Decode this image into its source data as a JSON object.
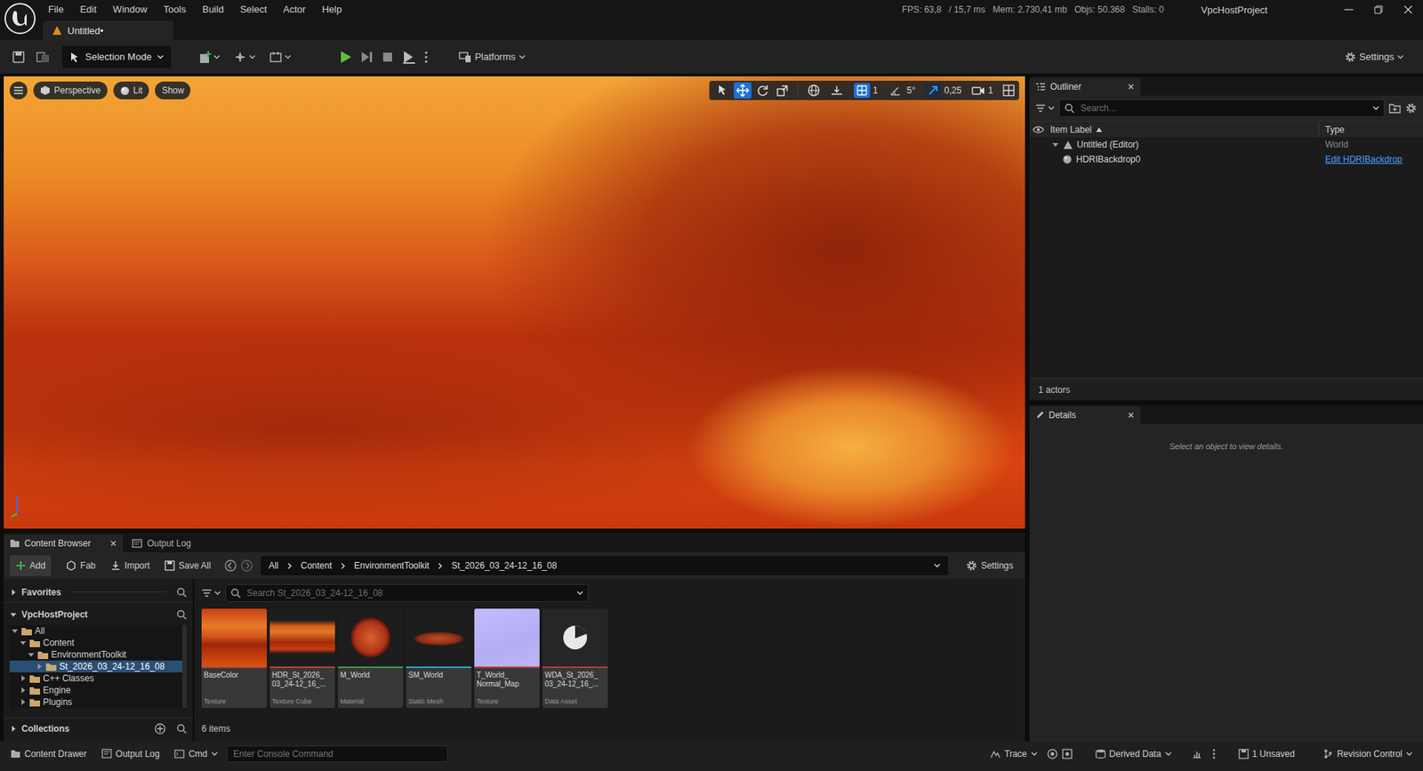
{
  "project": "VpcHostProject",
  "menu": [
    "File",
    "Edit",
    "Window",
    "Tools",
    "Build",
    "Select",
    "Actor",
    "Help"
  ],
  "stats": [
    "FPS: 63,8",
    "/ 15,7 ms",
    "Mem: 2.730,41 mb",
    "Objs: 50.368",
    "Stalls: 0"
  ],
  "level_tab": {
    "label": "Untitled•",
    "selected": true
  },
  "toolbar": {
    "mode": "Selection Mode",
    "platforms": "Platforms",
    "settings": "Settings"
  },
  "viewport": {
    "view_buttons": [
      {
        "label": "Perspective",
        "kind": "camera"
      },
      {
        "label": "Lit",
        "kind": "lighting"
      },
      {
        "label": "Show",
        "kind": "plain"
      }
    ],
    "transform_tools": [
      {
        "kind": "select",
        "selected": false
      },
      {
        "kind": "translate",
        "selected": true
      },
      {
        "kind": "rotate",
        "selected": false
      },
      {
        "kind": "scale",
        "selected": false
      }
    ],
    "snaps": [
      {
        "kind": "grid",
        "value": "1",
        "on": true
      },
      {
        "kind": "rotation",
        "value": "5°",
        "on": false
      },
      {
        "kind": "scale",
        "value": "0,25",
        "on": true
      }
    ],
    "camera_speed": "1"
  },
  "outliner": {
    "title": "Outliner",
    "search_placeholder": "Search...",
    "columns": [
      "Item Label",
      "Type"
    ],
    "sort_ascending": true,
    "rows": [
      {
        "label": "Untitled (Editor)",
        "type": "World",
        "kind": "world",
        "expanded": true,
        "link": false
      },
      {
        "label": "HDRIBackdrop0",
        "type": "Edit HDRIBackdrop",
        "kind": "actor",
        "expanded": false,
        "link": true
      }
    ],
    "footer": "1 actors"
  },
  "details": {
    "title": "Details",
    "empty_text": "Select an object to view details."
  },
  "content_browser": {
    "tabs": [
      {
        "label": "Content Browser",
        "selected": true
      },
      {
        "label": "Output Log",
        "selected": false
      }
    ],
    "actions": [
      "Add",
      "Fab",
      "Import",
      "Save All"
    ],
    "breadcrumb": [
      "All",
      "Content",
      "EnvironmentToolkit",
      "St_2026_03_24-12_16_08"
    ],
    "settings": "Settings",
    "sources": {
      "favorites": "Favorites",
      "favorites_expanded": false,
      "project": "VpcHostProject",
      "project_expanded": true,
      "tree": [
        {
          "label": "All",
          "level": 0,
          "expanded": true,
          "selected": false
        },
        {
          "label": "Content",
          "level": 1,
          "expanded": true,
          "selected": false
        },
        {
          "label": "EnvironmentToolkit",
          "level": 2,
          "expanded": true,
          "selected": false
        },
        {
          "label": "St_2026_03_24-12_16_08",
          "level": 3,
          "expanded": false,
          "selected": true
        },
        {
          "label": "C++ Classes",
          "level": 1,
          "expanded": false,
          "selected": false
        },
        {
          "label": "Engine",
          "level": 1,
          "expanded": false,
          "selected": false
        },
        {
          "label": "Plugins",
          "level": 1,
          "expanded": false,
          "selected": false
        }
      ],
      "collections": "Collections",
      "collections_expanded": false
    },
    "search_placeholder": "Search St_2026_03_24-12_16_08",
    "assets": [
      {
        "name_lines": [
          "BaseColor"
        ],
        "type": "Texture",
        "kind": "panorama",
        "color": "#c0403a"
      },
      {
        "name_lines": [
          "HDR_St_2026_",
          "03_24-12_16_..."
        ],
        "type": "Texture Cube",
        "kind": "hdr",
        "color": "#c0403a"
      },
      {
        "name_lines": [
          "M_World"
        ],
        "type": "Material",
        "kind": "sphere",
        "color": "#3f9a4e"
      },
      {
        "name_lines": [
          "SM_World"
        ],
        "type": "Static Mesh",
        "kind": "mesh",
        "color": "#2aa6c8"
      },
      {
        "name_lines": [
          "T_World_",
          "Normal_Map"
        ],
        "type": "Texture",
        "kind": "normal",
        "color": "#c0403a"
      },
      {
        "name_lines": [
          "WDA_St_2026_",
          "03_24-12_16_..."
        ],
        "type": "Data Asset",
        "kind": "data",
        "color": "#b83b3b"
      }
    ],
    "count": "6 items"
  },
  "status_bar": {
    "left": [
      "Content Drawer",
      "Output Log",
      "Cmd"
    ],
    "console_placeholder": "Enter Console Command",
    "right": [
      "Trace",
      "Derived Data",
      "1 Unsaved",
      "Revision Control"
    ]
  }
}
